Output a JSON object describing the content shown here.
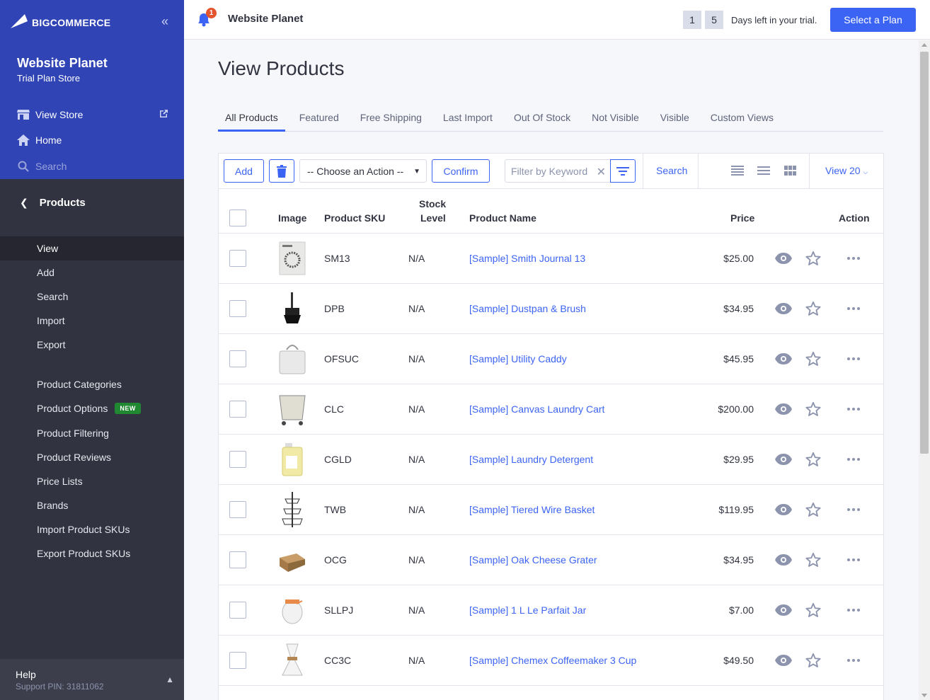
{
  "sidebar": {
    "logo_text": "BIGCOMMERCE",
    "store_name": "Website Planet",
    "store_plan": "Trial Plan Store",
    "view_store": "View Store",
    "home": "Home",
    "search": "Search",
    "section": "Products",
    "sub_items": [
      "View",
      "Add",
      "Search",
      "Import",
      "Export"
    ],
    "more_items": [
      "Product Categories",
      "Product Options",
      "Product Filtering",
      "Product Reviews",
      "Price Lists",
      "Brands",
      "Import Product SKUs",
      "Export Product SKUs"
    ],
    "new_badge": "NEW",
    "help": "Help",
    "support_pin": "Support PIN: 31811062"
  },
  "header": {
    "notification_count": "1",
    "store_name": "Website Planet",
    "trial_digit_1": "1",
    "trial_digit_2": "5",
    "trial_text": "Days left in your trial.",
    "plan_button": "Select a Plan"
  },
  "page": {
    "title": "View Products",
    "tabs": [
      "All Products",
      "Featured",
      "Free Shipping",
      "Last Import",
      "Out Of Stock",
      "Not Visible",
      "Visible",
      "Custom Views"
    ]
  },
  "toolbar": {
    "add": "Add",
    "action_select": "-- Choose an Action --",
    "confirm": "Confirm",
    "filter_placeholder": "Filter by Keyword",
    "search": "Search",
    "view_count": "View 20"
  },
  "table": {
    "headers": {
      "image": "Image",
      "sku": "Product SKU",
      "stock_1": "Stock",
      "stock_2": "Level",
      "name": "Product Name",
      "price": "Price",
      "action": "Action"
    },
    "rows": [
      {
        "sku": "SM13",
        "stock": "N/A",
        "name": "[Sample] Smith Journal 13",
        "price": "$25.00"
      },
      {
        "sku": "DPB",
        "stock": "N/A",
        "name": "[Sample] Dustpan & Brush",
        "price": "$34.95"
      },
      {
        "sku": "OFSUC",
        "stock": "N/A",
        "name": "[Sample] Utility Caddy",
        "price": "$45.95"
      },
      {
        "sku": "CLC",
        "stock": "N/A",
        "name": "[Sample] Canvas Laundry Cart",
        "price": "$200.00"
      },
      {
        "sku": "CGLD",
        "stock": "N/A",
        "name": "[Sample] Laundry Detergent",
        "price": "$29.95"
      },
      {
        "sku": "TWB",
        "stock": "N/A",
        "name": "[Sample] Tiered Wire Basket",
        "price": "$119.95"
      },
      {
        "sku": "OCG",
        "stock": "N/A",
        "name": "[Sample] Oak Cheese Grater",
        "price": "$34.95"
      },
      {
        "sku": "SLLPJ",
        "stock": "N/A",
        "name": "[Sample] 1 L Le Parfait Jar",
        "price": "$7.00"
      },
      {
        "sku": "CC3C",
        "stock": "N/A",
        "name": "[Sample] Chemex Coffeemaker 3 Cup",
        "price": "$49.50"
      }
    ]
  },
  "colors": {
    "sidebar_top": "#3044b5",
    "sidebar": "#313440",
    "accent": "#3c64f4",
    "new_badge": "#208831",
    "notify": "#e3542f"
  }
}
